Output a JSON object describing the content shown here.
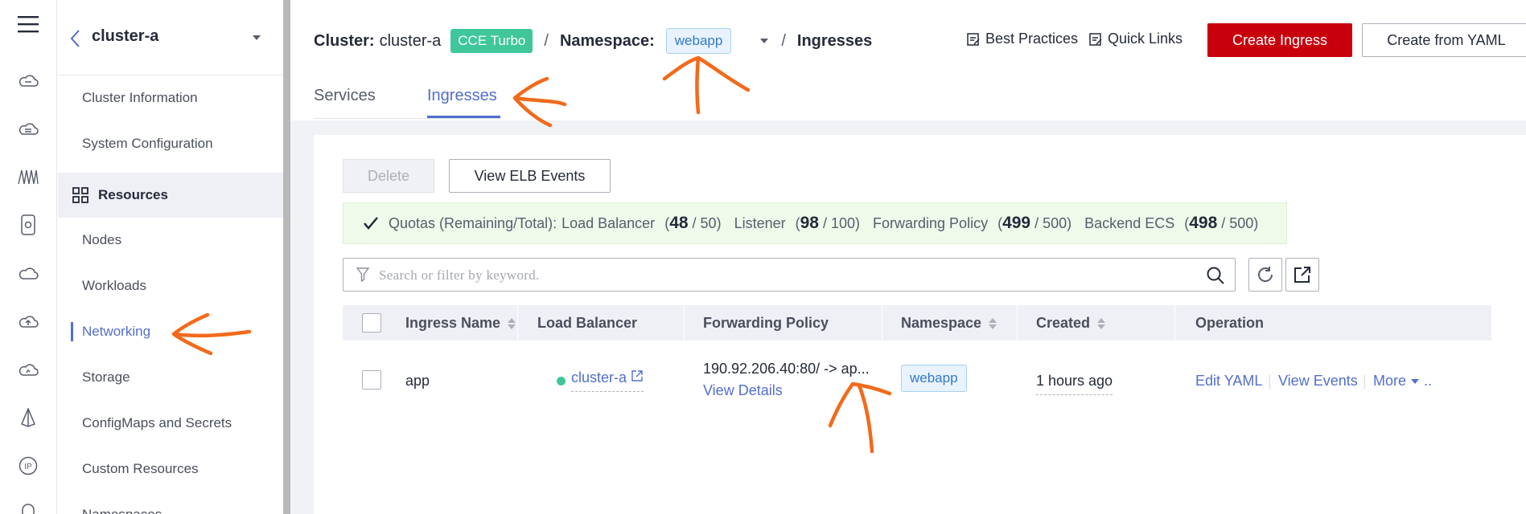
{
  "sidebar": {
    "cluster_name": "cluster-a",
    "items": [
      {
        "label": "Cluster Information"
      },
      {
        "label": "System Configuration"
      },
      {
        "label": "Resources"
      },
      {
        "label": "Nodes"
      },
      {
        "label": "Workloads"
      },
      {
        "label": "Networking"
      },
      {
        "label": "Storage"
      },
      {
        "label": "ConfigMaps and Secrets"
      },
      {
        "label": "Custom Resources"
      },
      {
        "label": "Namespaces"
      }
    ]
  },
  "rail_icons": [
    "menu-icon",
    "cloud-service-icon",
    "cloud-service-icon",
    "helm-icon",
    "device-icon",
    "cloud-icon",
    "cloud-upload-icon",
    "cloud-monitor-icon",
    "cone-icon",
    "ip-icon",
    "bell-icon"
  ],
  "header": {
    "cluster_label": "Cluster:",
    "cluster_value": "cluster-a",
    "cluster_tag": "CCE Turbo",
    "separator": "/",
    "namespace_label": "Namespace:",
    "namespace_value": "webapp",
    "page": "Ingresses",
    "best_practices": "Best Practices",
    "quick_links": "Quick Links",
    "create_ingress": "Create Ingress",
    "create_from_yaml": "Create from YAML"
  },
  "tabs": [
    {
      "label": "Services"
    },
    {
      "label": "Ingresses"
    }
  ],
  "toolbar": {
    "delete": "Delete",
    "view_elb_events": "View ELB Events"
  },
  "quota": {
    "label": "Quotas (Remaining/Total):",
    "items": [
      {
        "name": "Load Balancer",
        "open": "(",
        "remaining": "48",
        "total": "/ 50)"
      },
      {
        "name": "Listener",
        "open": "(",
        "remaining": "98",
        "total": "/ 100)"
      },
      {
        "name": "Forwarding Policy",
        "open": "(",
        "remaining": "499",
        "total": "/ 500)"
      },
      {
        "name": "Backend ECS",
        "open": "(",
        "remaining": "498",
        "total": "/ 500)"
      }
    ]
  },
  "search": {
    "placeholder": "Search or filter by keyword."
  },
  "table": {
    "columns": [
      "Ingress Name",
      "Load Balancer",
      "Forwarding Policy",
      "Namespace",
      "Created",
      "Operation"
    ],
    "rows": [
      {
        "name": "app",
        "load_balancer": "cluster-a",
        "forwarding_policy": "190.92.206.40:80/ -> ap...",
        "view_details": "View Details",
        "namespace": "webapp",
        "created": "1 hours ago",
        "op_edit": "Edit YAML",
        "op_events": "View Events",
        "op_more": "More"
      }
    ]
  },
  "colors": {
    "brand_red": "#c7000b",
    "accent_blue": "#526ecc",
    "turbo_green": "#3fc79a",
    "annotation_orange": "#f26a1b"
  }
}
